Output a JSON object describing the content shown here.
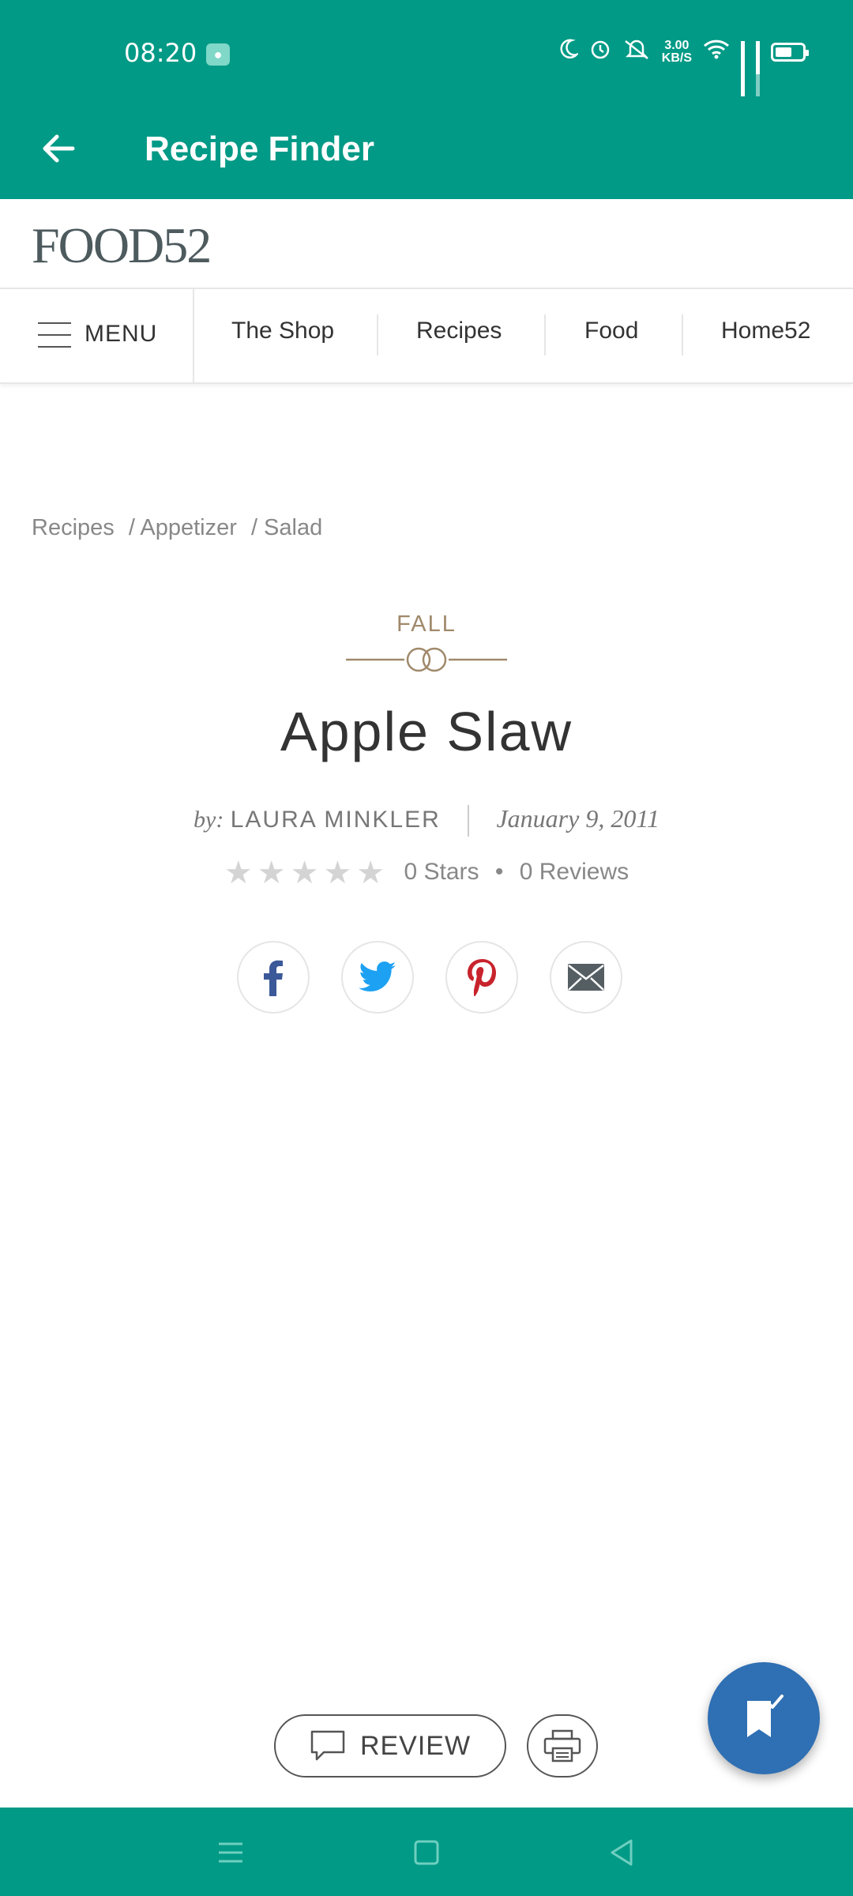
{
  "status_bar": {
    "time": "08:20",
    "net_speed_value": "3.00",
    "net_speed_unit": "KB/S",
    "icons": [
      "moon-icon",
      "alarm-icon",
      "mute-icon",
      "wifi-icon",
      "signal-icon",
      "signal-icon",
      "battery-icon"
    ]
  },
  "app_bar": {
    "title": "Recipe Finder"
  },
  "brand": {
    "logo": "FOOD52"
  },
  "nav": {
    "menu_label": "MENU",
    "items": [
      "The Shop",
      "Recipes",
      "Food",
      "Home52"
    ]
  },
  "breadcrumb": [
    "Recipes",
    "/ Appetizer",
    "/ Salad"
  ],
  "recipe": {
    "tag": "FALL",
    "title": "Apple Slaw",
    "by_prefix": "by:",
    "author": "LAURA MINKLER",
    "date": "January 9, 2011",
    "stars_text": "★★★★★",
    "rating_value": 0,
    "stars_label": "0 Stars",
    "dot": "•",
    "reviews_label": "0 Reviews"
  },
  "share": [
    "facebook-icon",
    "twitter-icon",
    "pinterest-icon",
    "email-icon"
  ],
  "actions": {
    "review_label": "REVIEW"
  },
  "colors": {
    "primary": "#009a86",
    "fab": "#2f6fb3",
    "tag": "#a0896b"
  }
}
